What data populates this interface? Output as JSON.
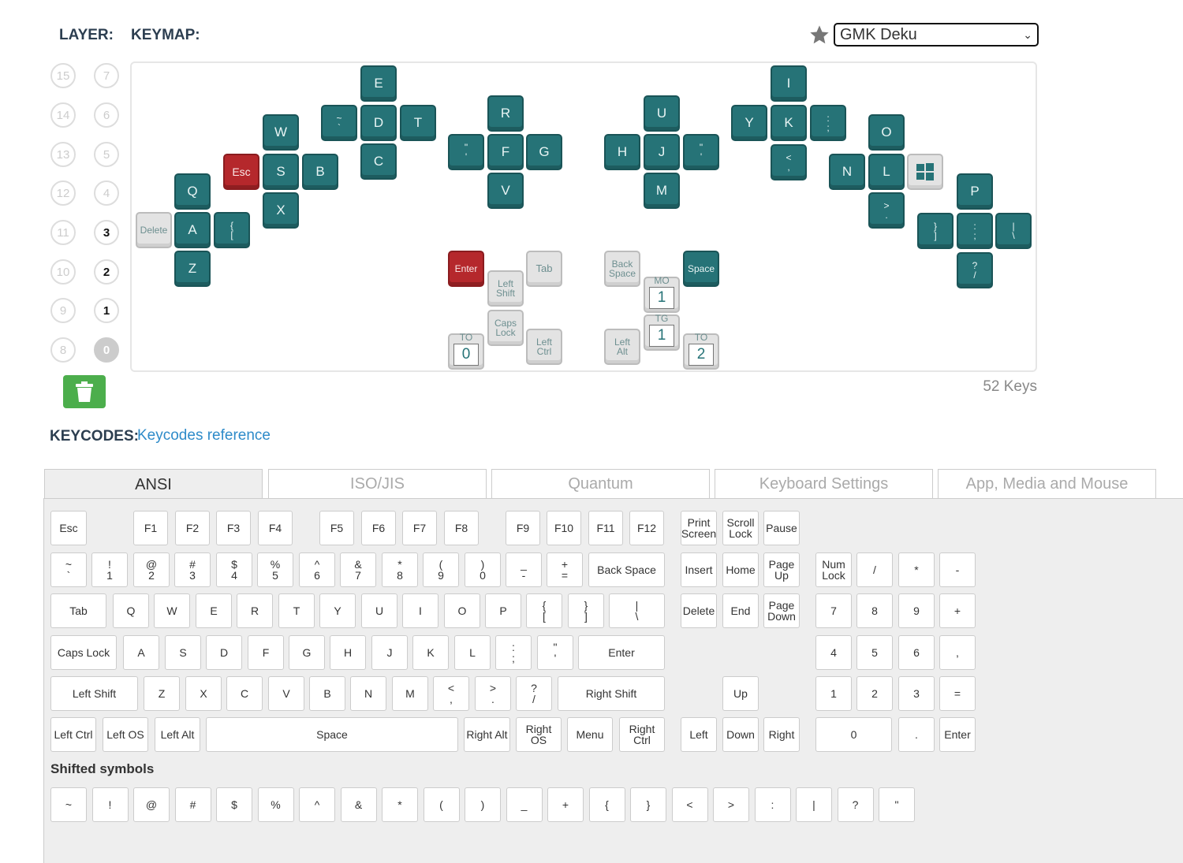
{
  "header": {
    "layer_label": "LAYER:",
    "keymap_label": "KEYMAP:",
    "theme_selected": "GMK Deku"
  },
  "layers": {
    "left": [
      "15",
      "14",
      "13",
      "12",
      "11",
      "10",
      "9",
      "8"
    ],
    "right": [
      "7",
      "6",
      "5",
      "4",
      "3",
      "2",
      "1",
      "0"
    ],
    "active": [
      "3",
      "2",
      "1"
    ],
    "selected": "0"
  },
  "board": {
    "key_count": "52 Keys"
  },
  "keys": [
    {
      "l": "E",
      "c": "t"
    },
    {
      "l": "I",
      "c": "t"
    },
    {
      "l": "~\n`",
      "c": "t"
    },
    {
      "l": "D",
      "c": "t"
    },
    {
      "l": "T",
      "c": "t"
    },
    {
      "l": "Y",
      "c": "t"
    },
    {
      "l": "K",
      "c": "t"
    },
    {
      "l": ":\n;",
      "c": "t"
    },
    {
      "l": "R",
      "c": "t"
    },
    {
      "l": "U",
      "c": "t"
    },
    {
      "l": "W",
      "c": "t"
    },
    {
      "l": "O",
      "c": "t"
    },
    {
      "l": "\"\n'",
      "c": "t"
    },
    {
      "l": "F",
      "c": "t"
    },
    {
      "l": "G",
      "c": "t"
    },
    {
      "l": "H",
      "c": "t"
    },
    {
      "l": "J",
      "c": "t"
    },
    {
      "l": "\"\n'",
      "c": "t"
    },
    {
      "l": "Esc",
      "c": "r"
    },
    {
      "l": "S",
      "c": "t"
    },
    {
      "l": "B",
      "c": "t"
    },
    {
      "l": "C",
      "c": "t"
    },
    {
      "l": "<\n,",
      "c": "t"
    },
    {
      "l": "N",
      "c": "t"
    },
    {
      "l": "L",
      "c": "t"
    },
    {
      "l": "win",
      "c": "g"
    },
    {
      "l": "Q",
      "c": "t"
    },
    {
      "l": "V",
      "c": "t"
    },
    {
      "l": "M",
      "c": "t"
    },
    {
      "l": "P",
      "c": "t"
    },
    {
      "l": "X",
      "c": "t"
    },
    {
      "l": ">\n.",
      "c": "t"
    },
    {
      "l": "Delete",
      "c": "g"
    },
    {
      "l": "A",
      "c": "t"
    },
    {
      "l": "{\n[",
      "c": "t"
    },
    {
      "l": "}\n]",
      "c": "t"
    },
    {
      "l": ":\n;",
      "c": "t"
    },
    {
      "l": "|\n\\",
      "c": "t"
    },
    {
      "l": "Z",
      "c": "t"
    },
    {
      "l": "Enter",
      "c": "r"
    },
    {
      "l": "Tab",
      "c": "g"
    },
    {
      "l": "Back\nSpace",
      "c": "g"
    },
    {
      "l": "Space",
      "c": "t"
    },
    {
      "l": "?\n/",
      "c": "t"
    },
    {
      "l": "Left\nShift",
      "c": "g"
    },
    {
      "l": "1",
      "c": "g",
      "layer": "MO"
    },
    {
      "l": "Caps\nLock",
      "c": "g"
    },
    {
      "l": "1",
      "c": "g",
      "layer": "TG"
    },
    {
      "l": "0",
      "c": "g",
      "layer": "TO"
    },
    {
      "l": "Left\nCtrl",
      "c": "g"
    },
    {
      "l": "Left\nAlt",
      "c": "g"
    },
    {
      "l": "2",
      "c": "g",
      "layer": "TO"
    }
  ],
  "keycodes": {
    "title": "KEYCODES:",
    "link": "Keycodes reference"
  },
  "tabs": [
    "ANSI",
    "ISO/JIS",
    "Quantum",
    "Keyboard Settings",
    "App, Media and Mouse"
  ],
  "ansi": [
    "Esc",
    "F1",
    "F2",
    "F3",
    "F4",
    "F5",
    "F6",
    "F7",
    "F8",
    "F9",
    "F10",
    "F11",
    "F12",
    "Print\nScreen",
    "Scroll\nLock",
    "Pause",
    "~\n`",
    "!\n1",
    "@\n2",
    "#\n3",
    "$\n4",
    "%\n5",
    "^\n6",
    "&\n7",
    "*\n8",
    "(\n9",
    ")\n0",
    "_\n-",
    "+\n=",
    "Back Space",
    "Insert",
    "Home",
    "Page\nUp",
    "Num\nLock",
    "/",
    "*",
    "-",
    "Tab",
    "Q",
    "W",
    "E",
    "R",
    "T",
    "Y",
    "U",
    "I",
    "O",
    "P",
    "{\n[",
    "}\n]",
    "|\n\\",
    "Delete",
    "End",
    "Page\nDown",
    "7",
    "8",
    "9",
    "+",
    "Caps Lock",
    "A",
    "S",
    "D",
    "F",
    "G",
    "H",
    "J",
    "K",
    "L",
    ":\n;",
    "\"\n'",
    "Enter",
    "4",
    "5",
    "6",
    ",",
    "Left Shift",
    "Z",
    "X",
    "C",
    "V",
    "B",
    "N",
    "M",
    "<\n,",
    ">\n.",
    "?\n/",
    "Right Shift",
    "Up",
    "1",
    "2",
    "3",
    "=",
    "Left Ctrl",
    "Left OS",
    "Left Alt",
    "Space",
    "Right Alt",
    "Right\nOS",
    "Menu",
    "Right\nCtrl",
    "Left",
    "Down",
    "Right",
    "0",
    ".",
    "Enter"
  ],
  "shifted_title": "Shifted symbols",
  "shifted": [
    "~",
    "!",
    "@",
    "#",
    "$",
    "%",
    "^",
    "&",
    "*",
    "(",
    ")",
    "_",
    "+",
    "{",
    "}",
    "<",
    ">",
    ":",
    "|",
    "?",
    "\""
  ]
}
